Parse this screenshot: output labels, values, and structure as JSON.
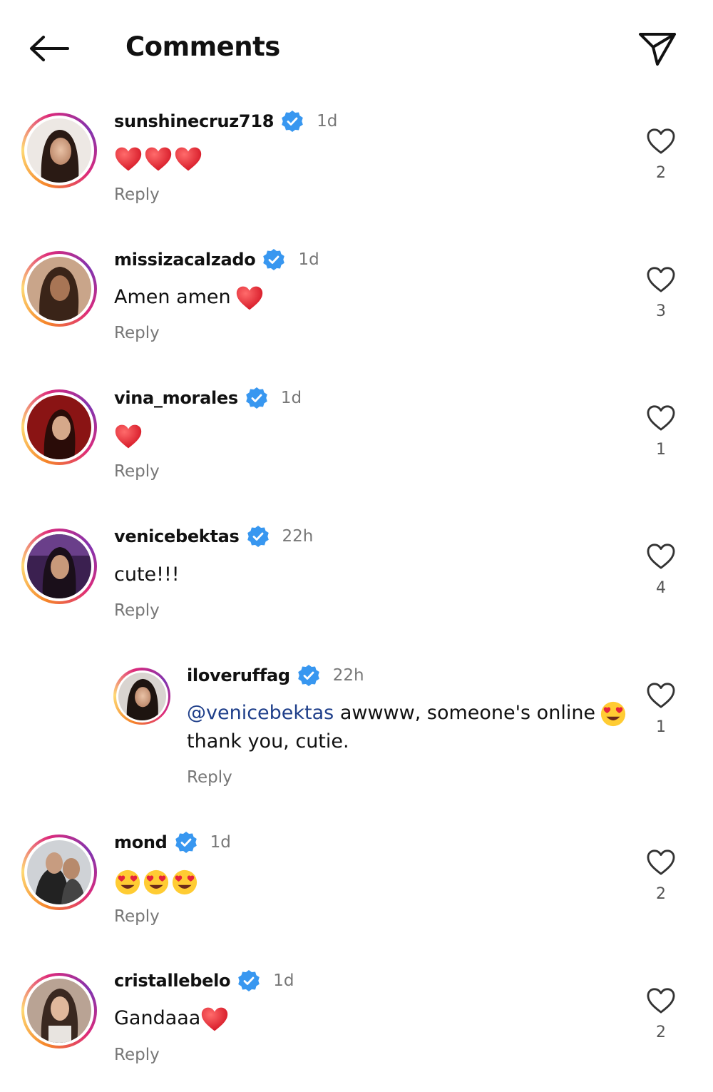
{
  "header": {
    "title": "Comments"
  },
  "comments": [
    {
      "username": "sunshinecruz718",
      "time": "1d",
      "text": "",
      "reply": "Reply",
      "likes": "2",
      "emoji": "red-heart x3"
    },
    {
      "username": "missizacalzado",
      "time": "1d",
      "text": "Amen amen",
      "reply": "Reply",
      "likes": "3",
      "emoji": "red-heart"
    },
    {
      "username": "vina_morales",
      "time": "1d",
      "text": "",
      "reply": "Reply",
      "likes": "1",
      "emoji": "red-heart"
    },
    {
      "username": "venicebektas",
      "time": "22h",
      "text": "cute!!!",
      "reply": "Reply",
      "likes": "4"
    },
    {
      "username": "iloveruffag",
      "time": "22h",
      "mention": "@venicebektas",
      "text": " awwww, someone's online",
      "text2": "thank you, cutie.",
      "reply": "Reply",
      "likes": "1",
      "emoji": "heart-eyes"
    },
    {
      "username": "mond",
      "time": "1d",
      "text": "",
      "reply": "Reply",
      "likes": "2",
      "emoji": "heart-eyes x3"
    },
    {
      "username": "cristallebelo",
      "time": "1d",
      "text": "Gandaaa",
      "reply": "Reply",
      "likes": "2",
      "emoji": "red-heart"
    }
  ],
  "colors": {
    "verified": "#3897f0",
    "heart_emoji": "#e0242f",
    "muted": "#777777"
  }
}
